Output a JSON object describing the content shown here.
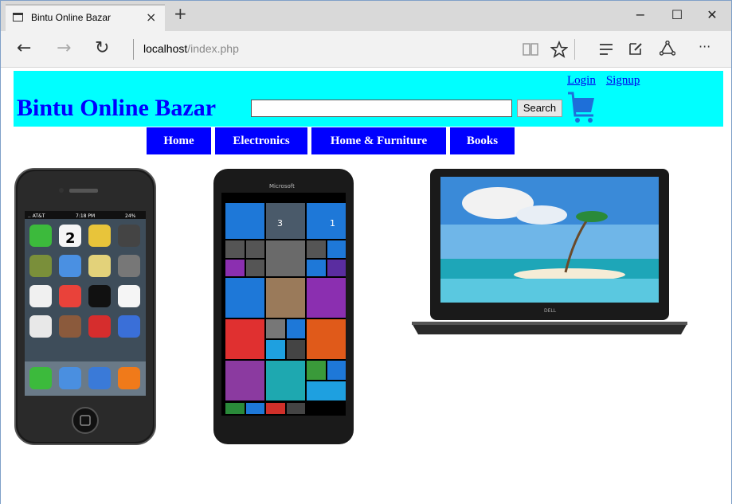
{
  "browser": {
    "tab_title": "Bintu Online Bazar",
    "tab_close": "×",
    "new_tab": "+",
    "address_host": "localhost",
    "address_path": "/index.php",
    "window_min": "−",
    "window_max": "☐",
    "window_close": "✕",
    "back": "←",
    "forward": "→",
    "refresh": "↻",
    "more": "···"
  },
  "site": {
    "title": "Bintu Online Bazar",
    "search_value": "",
    "search_button": "Search",
    "login": "Login",
    "signup": "Signup",
    "menu": [
      "Home",
      "Electronics",
      "Home & Furniture",
      "Books"
    ]
  },
  "phone1": {
    "carrier": ".. AT&T",
    "time": "7:18 PM",
    "battery": "24%",
    "date": "2"
  },
  "phone2": {
    "brand": "Microsoft",
    "tiles": {
      "calendar": "3",
      "outlook": "1"
    }
  },
  "laptop": {
    "brand": "DELL"
  },
  "colors": {
    "header": "#00ffff",
    "menu": "#0000ff",
    "title": "#0000ff"
  }
}
